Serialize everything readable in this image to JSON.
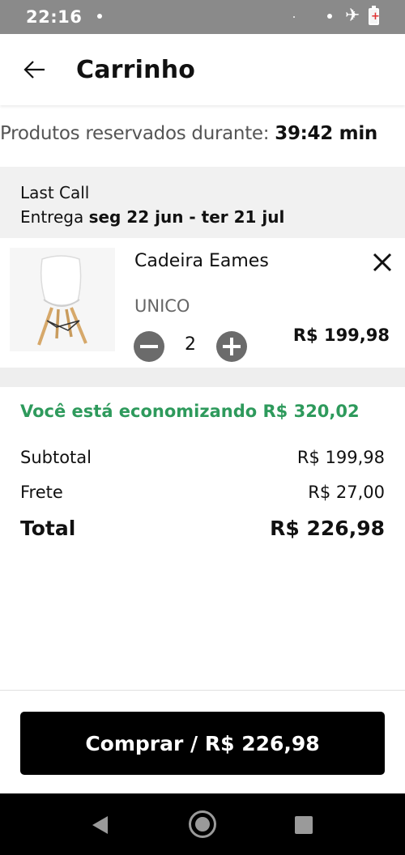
{
  "status_bar": {
    "time": "22:16",
    "icons": [
      "notification-dot-icon",
      "airplane-mode-icon",
      "battery-low-icon"
    ]
  },
  "app_bar": {
    "title": "Carrinho",
    "back_icon": "arrow-left-icon"
  },
  "reservation": {
    "label": "Produtos reservados durante:",
    "time": "39:42 min"
  },
  "shipping_group": {
    "name": "Last Call",
    "delivery_label": "Entrega",
    "delivery_range": "seg 22 jun - ter 21 jul"
  },
  "cart_item": {
    "name": "Cadeira Eames",
    "variant": "UNICO",
    "quantity": "2",
    "price": "R$ 199,98",
    "image": "eames-chair-image",
    "remove_icon": "close-icon",
    "decrease_icon": "minus-circle-icon",
    "increase_icon": "plus-circle-icon"
  },
  "summary": {
    "savings": "Você está economizando R$ 320,02",
    "savings_color": "#2e9a5c",
    "subtotal_label": "Subtotal",
    "subtotal_value": "R$ 199,98",
    "shipping_label": "Frete",
    "shipping_value": "R$ 27,00",
    "total_label": "Total",
    "total_value": "R$ 226,98"
  },
  "checkout": {
    "button_label": "Comprar / R$ 226,98"
  },
  "nav_bar": {
    "icons": [
      "back-triangle-icon",
      "home-circle-icon",
      "recent-apps-icon"
    ]
  }
}
